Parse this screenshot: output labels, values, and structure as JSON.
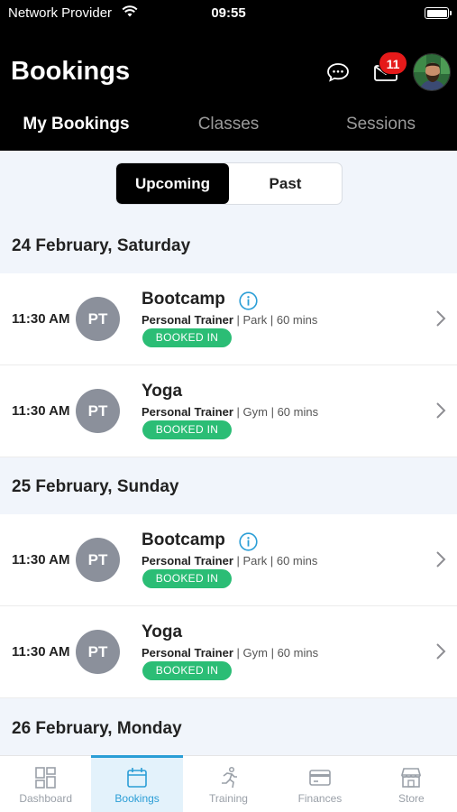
{
  "status": {
    "carrier": "Network Provider",
    "time": "09:55"
  },
  "header": {
    "title": "Bookings",
    "notification_count": "11"
  },
  "tabs": [
    {
      "label": "My Bookings",
      "active": true
    },
    {
      "label": "Classes",
      "active": false
    },
    {
      "label": "Sessions",
      "active": false
    }
  ],
  "segment": {
    "upcoming": "Upcoming",
    "past": "Past",
    "selected": "Upcoming"
  },
  "days": [
    {
      "date": "24 February, Saturday",
      "items": [
        {
          "time": "11:30 AM",
          "initials": "PT",
          "name": "Bootcamp",
          "has_info": true,
          "trainer": "Personal Trainer",
          "location": "Park",
          "duration": "60 mins",
          "status": "BOOKED IN"
        },
        {
          "time": "11:30 AM",
          "initials": "PT",
          "name": "Yoga",
          "has_info": false,
          "trainer": "Personal Trainer",
          "location": "Gym",
          "duration": "60 mins",
          "status": "BOOKED IN"
        }
      ]
    },
    {
      "date": "25 February, Sunday",
      "items": [
        {
          "time": "11:30 AM",
          "initials": "PT",
          "name": "Bootcamp",
          "has_info": true,
          "trainer": "Personal Trainer",
          "location": "Park",
          "duration": "60 mins",
          "status": "BOOKED IN"
        },
        {
          "time": "11:30 AM",
          "initials": "PT",
          "name": "Yoga",
          "has_info": false,
          "trainer": "Personal Trainer",
          "location": "Gym",
          "duration": "60 mins",
          "status": "BOOKED IN"
        }
      ]
    },
    {
      "date": "26 February, Monday",
      "items": []
    }
  ],
  "tabbar": [
    {
      "label": "Dashboard",
      "icon": "dashboard-icon",
      "active": false
    },
    {
      "label": "Bookings",
      "icon": "calendar-icon",
      "active": true
    },
    {
      "label": "Training",
      "icon": "running-icon",
      "active": false
    },
    {
      "label": "Finances",
      "icon": "card-icon",
      "active": false
    },
    {
      "label": "Store",
      "icon": "store-icon",
      "active": false
    }
  ],
  "colors": {
    "accent": "#2b9ed6",
    "booked": "#2bbd75",
    "badge": "#e51a1a",
    "header": "#000000"
  }
}
